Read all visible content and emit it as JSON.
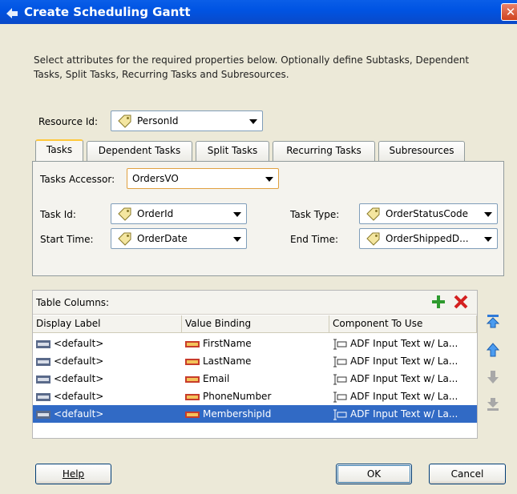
{
  "title": "Create Scheduling Gantt",
  "intro": "Select attributes for the required properties below.  Optionally define Subtasks, Dependent Tasks, Split Tasks, Recurring Tasks and Subresources.",
  "resource": {
    "label": "Resource Id:",
    "value": "PersonId"
  },
  "tabs": [
    "Tasks",
    "Dependent Tasks",
    "Split Tasks",
    "Recurring Tasks",
    "Subresources"
  ],
  "accessor": {
    "label": "Tasks Accessor:",
    "value": "OrdersVO"
  },
  "task_id": {
    "label": "Task Id:",
    "value": "OrderId"
  },
  "start_time": {
    "label": "Start Time:",
    "value": "OrderDate"
  },
  "task_type": {
    "label": "Task Type:",
    "value": "OrderStatusCode"
  },
  "end_time": {
    "label": "End Time:",
    "value": "OrderShippedD..."
  },
  "table": {
    "title": "Table Columns:",
    "headers": [
      "Display Label",
      "Value Binding",
      "Component To Use"
    ],
    "rows": [
      [
        "<default>",
        "FirstName",
        "ADF Input Text w/ La..."
      ],
      [
        "<default>",
        "LastName",
        "ADF Input Text w/ La..."
      ],
      [
        "<default>",
        "Email",
        "ADF Input Text w/ La..."
      ],
      [
        "<default>",
        "PhoneNumber",
        "ADF Input Text w/ La..."
      ],
      [
        "<default>",
        "MembershipId",
        "ADF Input Text w/ La..."
      ]
    ],
    "selected_row": 4
  },
  "buttons": {
    "help": "Help",
    "ok": "OK",
    "cancel": "Cancel"
  },
  "colors": {
    "title_bar": "#0054e3",
    "selection": "#316ac5",
    "dialog_bg": "#ece9d8"
  }
}
